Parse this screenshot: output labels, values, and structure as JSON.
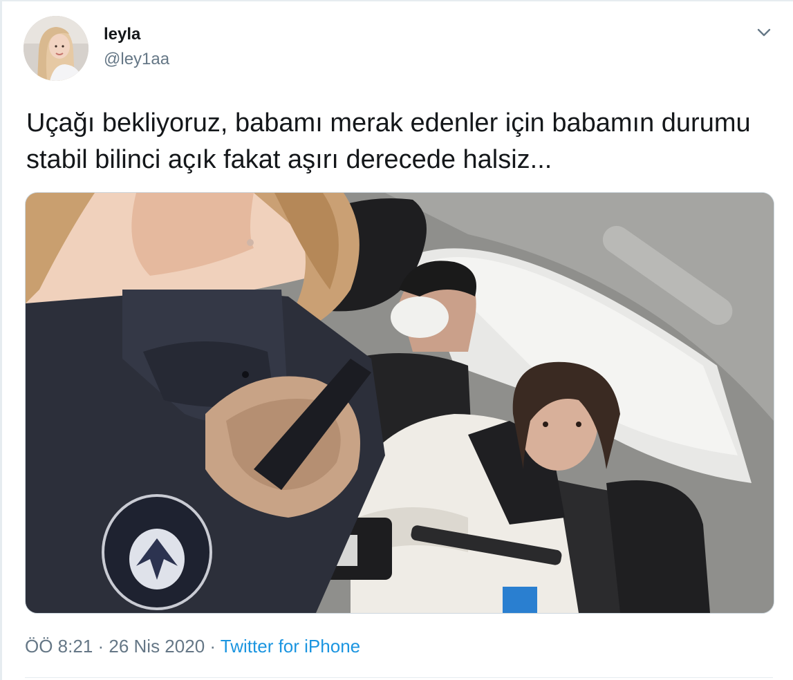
{
  "tweet": {
    "author_name": "leyla",
    "author_handle": "@ley1aa",
    "text": "Uçağı bekliyoruz, babamı merak edenler için babamın durumu stabil bilinci açık fakat aşırı derecede halsiz...",
    "time": "ÖÖ 8:21",
    "separator": " · ",
    "date": "26 Nis 2020",
    "source": "Twitter for iPhone"
  },
  "icons": {
    "more_menu": "chevron-down-icon",
    "avatar": "profile-photo",
    "media": "car-selfie-photo"
  },
  "colors": {
    "text_primary": "#14171a",
    "text_secondary": "#657786",
    "link": "#1b95e0",
    "border": "#e6ecf0"
  }
}
